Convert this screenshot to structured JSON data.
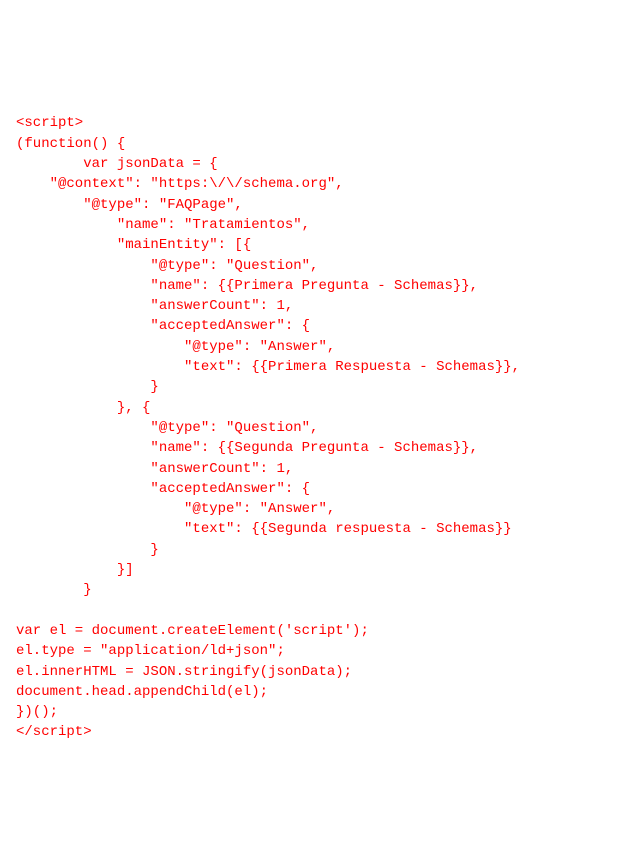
{
  "code": {
    "l1": "<script>",
    "l2": "(function() {",
    "l3": "        var jsonData = {",
    "l4": "    \"@context\": \"https:\\/\\/schema.org\",",
    "l5": "        \"@type\": \"FAQPage\",",
    "l6": "            \"name\": \"Tratamientos\",",
    "l7": "            \"mainEntity\": [{",
    "l8": "                \"@type\": \"Question\",",
    "l9": "                \"name\": {{Primera Pregunta - Schemas}},",
    "l10": "                \"answerCount\": 1,",
    "l11": "                \"acceptedAnswer\": {",
    "l12": "                    \"@type\": \"Answer\",",
    "l13": "                    \"text\": {{Primera Respuesta - Schemas}},",
    "l14": "                }",
    "l15": "            }, {",
    "l16": "                \"@type\": \"Question\",",
    "l17": "                \"name\": {{Segunda Pregunta - Schemas}},",
    "l18": "                \"answerCount\": 1,",
    "l19": "                \"acceptedAnswer\": {",
    "l20": "                    \"@type\": \"Answer\",",
    "l21": "                    \"text\": {{Segunda respuesta - Schemas}}",
    "l22": "                }",
    "l23": "            }]",
    "l24": "        }",
    "l25": "",
    "l26": "var el = document.createElement('script');",
    "l27": "el.type = \"application/ld+json\";",
    "l28": "el.innerHTML = JSON.stringify(jsonData);",
    "l29": "document.head.appendChild(el);",
    "l30": "})();",
    "l31": "</script>"
  }
}
